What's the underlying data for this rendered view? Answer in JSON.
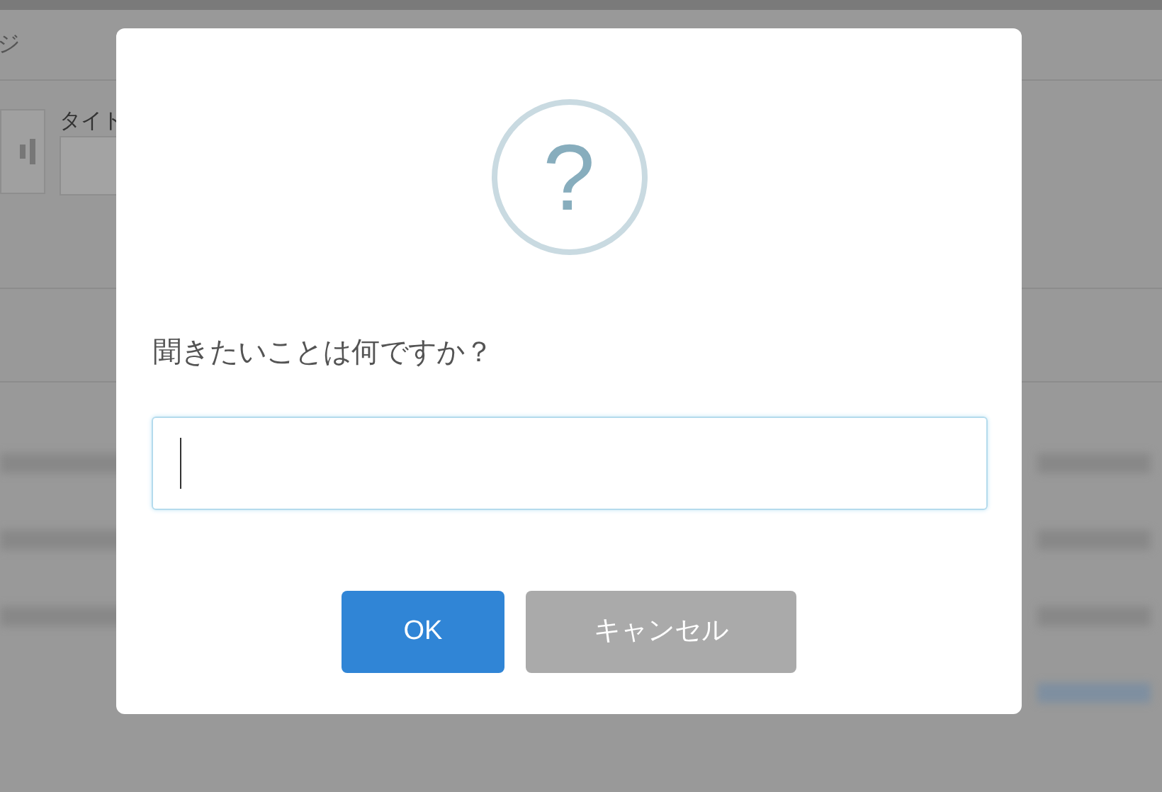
{
  "background": {
    "header_title": "ジ",
    "field_label": "タイト"
  },
  "dialog": {
    "icon": "?",
    "prompt": "聞きたいことは何ですか？",
    "input": {
      "focused": true
    },
    "buttons": [
      {
        "label": "OK",
        "kind": "confirm"
      },
      {
        "label": "キャンセル",
        "kind": "cancel"
      }
    ]
  }
}
